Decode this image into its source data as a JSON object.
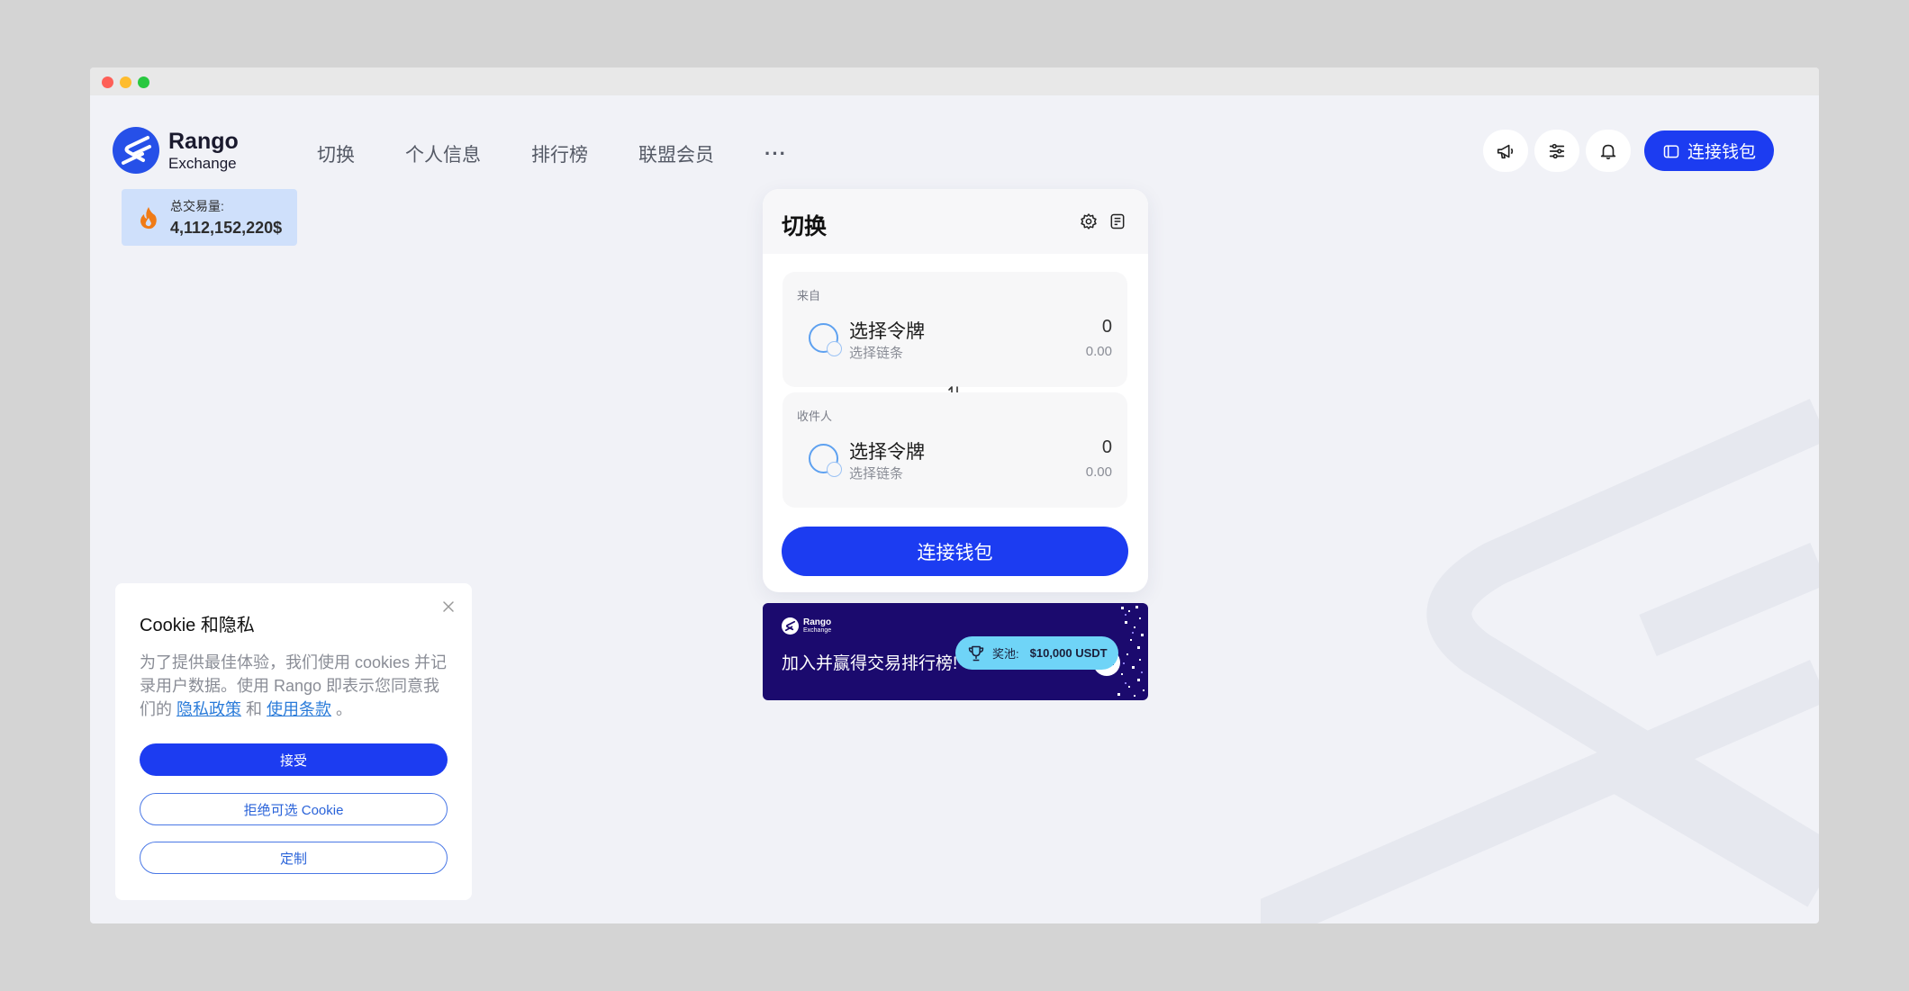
{
  "brand": {
    "name": "Rango",
    "sub": "Exchange"
  },
  "nav": {
    "items": [
      "切换",
      "个人信息",
      "排行榜",
      "联盟会员"
    ],
    "more": "···"
  },
  "header": {
    "connect_label": "连接钱包"
  },
  "volume": {
    "label": "总交易量:",
    "value": "4,112,152,220$"
  },
  "swap": {
    "title": "切换",
    "from": {
      "label": "来自",
      "token": "选择令牌",
      "chain": "选择链条",
      "amount": "0",
      "usd": "0.00"
    },
    "to": {
      "label": "收件人",
      "token": "选择令牌",
      "chain": "选择链条",
      "amount": "0",
      "usd": "0.00"
    },
    "connect_label": "连接钱包"
  },
  "banner": {
    "logo_title": "Rango",
    "logo_sub": "Exchange",
    "text": "加入并赢得交易排行榜!",
    "prize_label": "奖池:",
    "prize_amount": "$10,000 USDT"
  },
  "cookie": {
    "title": "Cookie 和隐私",
    "body_prefix": "为了提供最佳体验，我们使用 cookies 并记录用户数据。使用 Rango 即表示您同意我们的 ",
    "privacy_link": "隐私政策",
    "and_text": " 和 ",
    "terms_link": "使用条款",
    "suffix": " 。",
    "accept": "接受",
    "reject": "拒绝可选 Cookie",
    "customize": "定制"
  },
  "colors": {
    "primary": "#1c3cf1",
    "background": "#f1f2f7",
    "badge": "#cfe0fb",
    "banner": "#1b0a6e",
    "prize": "#6fd4f7"
  }
}
